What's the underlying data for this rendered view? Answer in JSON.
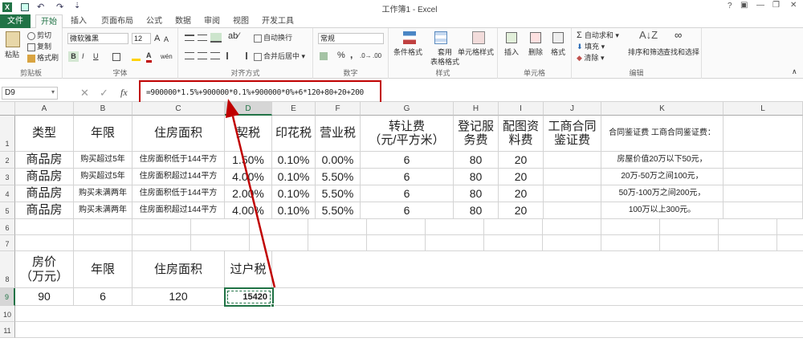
{
  "app": {
    "title": "工作簿1 - Excel",
    "window_buttons": [
      "?",
      "▣",
      "—",
      "❐",
      "✕"
    ],
    "quick_access": [
      "save-icon",
      "undo-icon",
      "redo-icon",
      "customize-icon"
    ]
  },
  "tabs": [
    "文件",
    "开始",
    "插入",
    "页面布局",
    "公式",
    "数据",
    "审阅",
    "视图",
    "开发工具"
  ],
  "active_tab": "开始",
  "ribbon": {
    "clipboard": {
      "label": "剪贴板",
      "paste": "粘贴",
      "cut": "剪切",
      "copy": "复制",
      "format_painter": "格式刷"
    },
    "font": {
      "label": "字体",
      "name": "微软雅黑",
      "size": "12",
      "bold": "B",
      "italic": "I",
      "underline": "U",
      "grow": "A",
      "shrink": "A",
      "wen": "wén"
    },
    "alignment": {
      "label": "对齐方式",
      "wrap": "自动换行",
      "merge": "合并后居中"
    },
    "number": {
      "label": "数字",
      "format": "常规",
      "percent": "%",
      "comma": ","
    },
    "styles": {
      "label": "样式",
      "conditional": "条件格式",
      "table": "套用\n表格格式",
      "cell_styles": "单元格样式"
    },
    "cells": {
      "label": "单元格",
      "insert": "插入",
      "delete": "删除",
      "format": "格式"
    },
    "editing": {
      "label": "编辑",
      "autosum": "自动求和",
      "fill": "填充",
      "clear": "清除",
      "sort": "排序和筛选",
      "find": "查找和选择"
    }
  },
  "formula_bar": {
    "name_box": "D9",
    "fx": "fx",
    "formula": "=900000*1.5%+900000*0.1%+900000*0%+6*120+80+20+200"
  },
  "columns": [
    "A",
    "B",
    "C",
    "D",
    "E",
    "F",
    "G",
    "H",
    "I",
    "J",
    "K",
    "L"
  ],
  "rows": [
    "1",
    "2",
    "3",
    "4",
    "5",
    "6",
    "7",
    "8",
    "9",
    "10",
    "11"
  ],
  "cells": {
    "A1": "类型",
    "B1": "年限",
    "C1": "住房面积",
    "D1": "契税",
    "E1": "印花税",
    "F1": "营业税",
    "G1": "转让费\n（元/平方米）",
    "H1": "登记服\n务费",
    "I1": "配图资\n料费",
    "J1": "工商合同\n鉴证费",
    "K1": "合同鉴证费 工商合同鉴证费：",
    "A2": "商品房",
    "B2": "购买超过5年",
    "C2": "住房面积低于144平方",
    "D2": "1.50%",
    "E2": "0.10%",
    "F2": "0.00%",
    "G2": "6",
    "H2": "80",
    "I2": "20",
    "K2": "房屋价值20万以下50元，",
    "A3": "商品房",
    "B3": "购买超过5年",
    "C3": "住房面积超过144平方",
    "D3": "4.00%",
    "E3": "0.10%",
    "F3": "5.50%",
    "G3": "6",
    "H3": "80",
    "I3": "20",
    "K3": "20万-50万之间100元，",
    "A4": "商品房",
    "B4": "购买未满两年",
    "C4": "住房面积低于144平方",
    "D4": "2.00%",
    "E4": "0.10%",
    "F4": "5.50%",
    "G4": "6",
    "H4": "80",
    "I4": "20",
    "K4": "50万-100万之间200元，",
    "A5": "商品房",
    "B5": "购买未满两年",
    "C5": "住房面积超过144平方",
    "D5": "4.00%",
    "E5": "0.10%",
    "F5": "5.50%",
    "G5": "6",
    "H5": "80",
    "I5": "20",
    "K5": "100万以上300元。",
    "A8": "房价\n（万元）",
    "B8": "年限",
    "C8": "住房面积",
    "D8": "过户税",
    "A9": "90",
    "B9": "6",
    "C9": "120",
    "D9": "15420"
  },
  "colors": {
    "excel_green": "#217346",
    "annotation_red": "#c00000",
    "selected_header": "#d6d6d6"
  }
}
